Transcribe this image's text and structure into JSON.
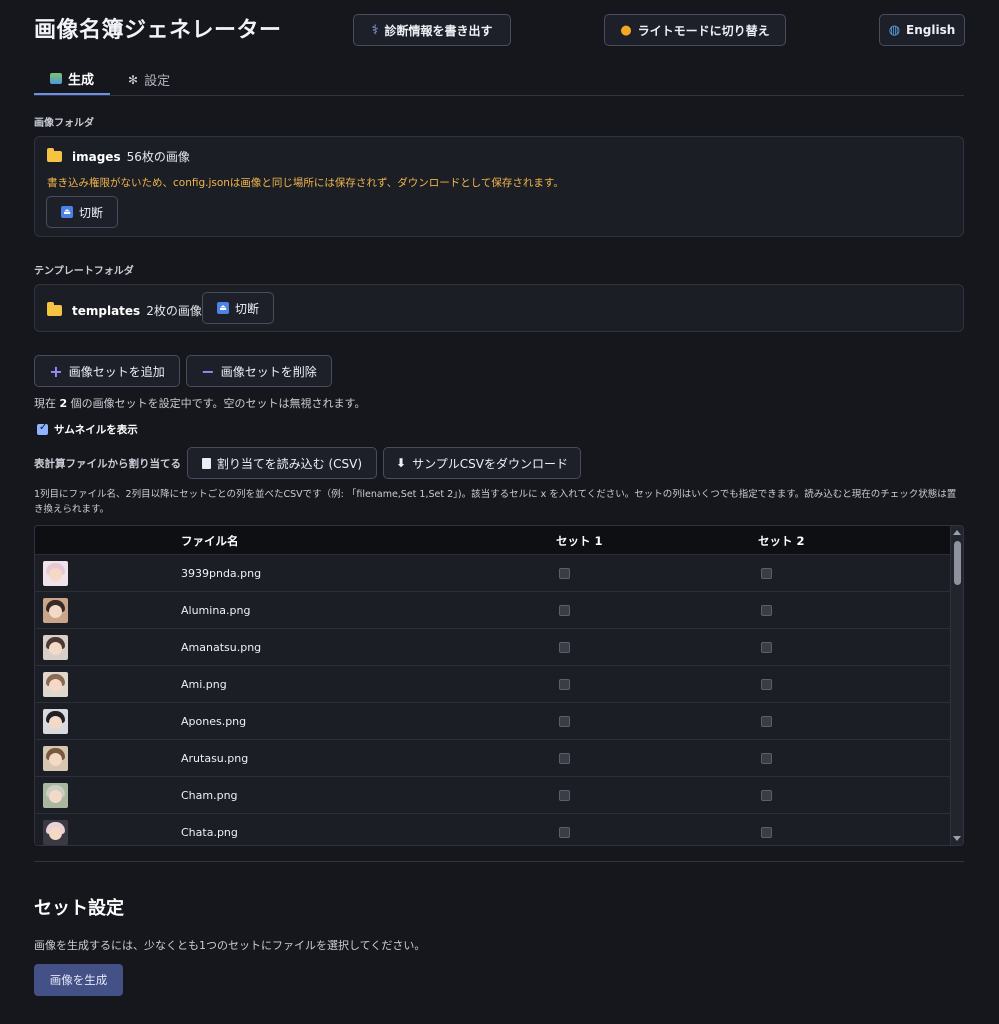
{
  "app": {
    "title": "画像名簿ジェネレーター"
  },
  "header": {
    "diagnostics_label": "診断情報を書き出す",
    "theme_label": "ライトモードに切り替え",
    "language_label": "English",
    "diagnostics_icon": "stethoscope-icon",
    "theme_icon": "sun-icon",
    "language_icon": "globe-icon"
  },
  "tabs": [
    {
      "label": "生成",
      "icon": "image-icon",
      "active": true
    },
    {
      "label": "設定",
      "icon": "gear-icon",
      "active": false
    }
  ],
  "image_folder": {
    "section_label": "画像フォルダ",
    "name": "images",
    "count": "56枚の画像",
    "warning": "書き込み権限がないため、config.jsonは画像と同じ場所には保存されず、ダウンロードとして保存されます。",
    "disconnect_label": "切断"
  },
  "template_folder": {
    "section_label": "テンプレートフォルダ",
    "name": "templates",
    "count": "2枚の画像",
    "disconnect_label": "切断"
  },
  "sets": {
    "add_label": "画像セットを追加",
    "remove_label": "画像セットを削除",
    "status_prefix": "現在",
    "status_count": "2",
    "status_suffix": "個の画像セットを設定中です。空のセットは無視されます。",
    "show_thumbnails_label": "サムネイルを表示",
    "show_thumbnails_checked": true
  },
  "csv": {
    "label": "表計算ファイルから割り当てる",
    "import_label": "割り当てを読み込む (CSV)",
    "download_label": "サンプルCSVをダウンロード",
    "help": "1列目にファイル名、2列目以降にセットごとの列を並べたCSVです（例: 「filename,Set 1,Set 2」)。該当するセルに x を入れてください。セットの列はいくつでも指定できます。読み込むと現在のチェック状態は置き換えられます。"
  },
  "table": {
    "headers": {
      "file": "ファイル名",
      "set1": "セット 1",
      "set2": "セット 2"
    },
    "rows": [
      {
        "file": "3939pnda.png",
        "set1": false,
        "set2": false,
        "hair": "#e7c9d6",
        "bg": "#f1e3ea"
      },
      {
        "file": "Alumina.png",
        "set1": false,
        "set2": false,
        "hair": "#3a2a25",
        "bg": "#c9a58a"
      },
      {
        "file": "Amanatsu.png",
        "set1": false,
        "set2": false,
        "hair": "#4a3a33",
        "bg": "#d8cfc8"
      },
      {
        "file": "Ami.png",
        "set1": false,
        "set2": false,
        "hair": "#8a6a55",
        "bg": "#e0d7cf"
      },
      {
        "file": "Apones.png",
        "set1": false,
        "set2": false,
        "hair": "#1f1f24",
        "bg": "#d9d9de"
      },
      {
        "file": "Arutasu.png",
        "set1": false,
        "set2": false,
        "hair": "#7a5a3e",
        "bg": "#d6c7b2"
      },
      {
        "file": "Cham.png",
        "set1": false,
        "set2": false,
        "hair": "#c9cfc4",
        "bg": "#a9b89e"
      },
      {
        "file": "Chata.png",
        "set1": false,
        "set2": false,
        "hair": "#e9d2d8",
        "bg": "#3b3a44"
      }
    ]
  },
  "set_settings": {
    "title": "セット設定",
    "hint": "画像を生成するには、少なくとも1つのセットにファイルを選択してください。",
    "generate_label": "画像を生成"
  }
}
